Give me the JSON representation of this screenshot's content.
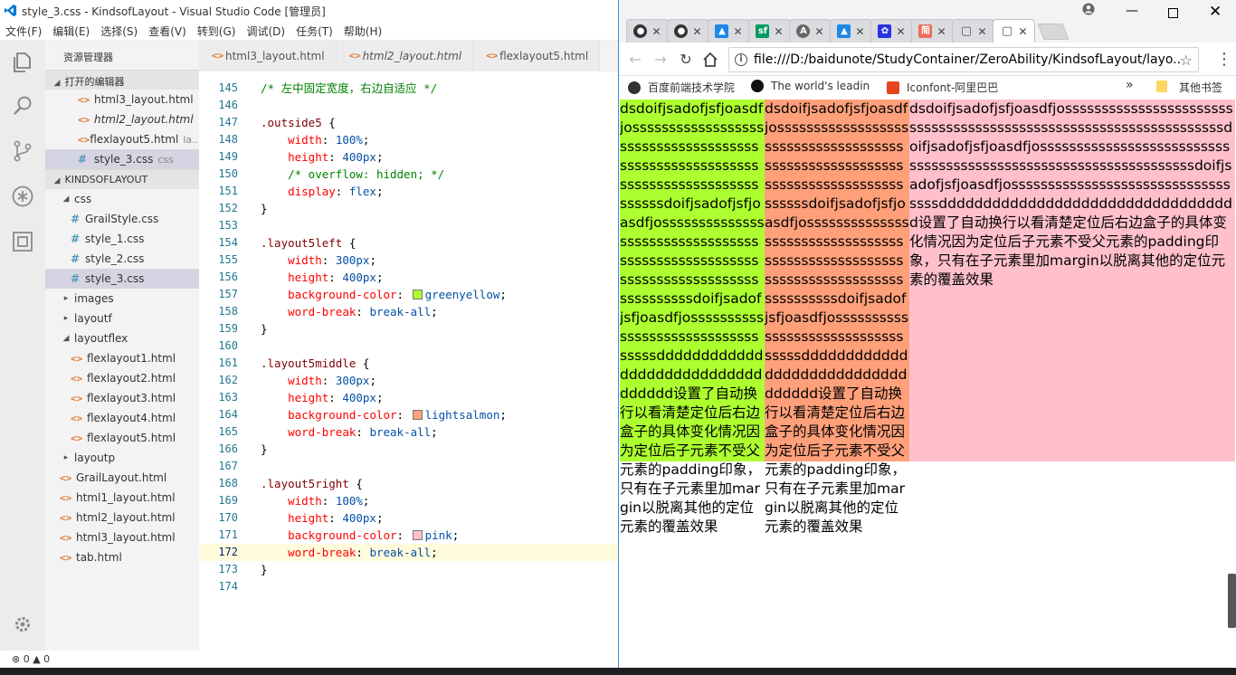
{
  "vscode": {
    "title": "style_3.css - KindsofLayout - Visual Studio Code [管理员]",
    "menu": [
      "文件(F)",
      "编辑(E)",
      "选择(S)",
      "查看(V)",
      "转到(G)",
      "调试(D)",
      "任务(T)",
      "帮助(H)"
    ],
    "explorer_title": "资源管理器",
    "open_editors_label": "打开的编辑器",
    "open_editors": [
      {
        "label": "html3_layout.html",
        "type": "html",
        "italic": false
      },
      {
        "label": "html2_layout.html",
        "type": "html",
        "italic": true
      },
      {
        "label": "flexlayout5.html",
        "type": "html",
        "italic": false,
        "desc": "la..."
      },
      {
        "label": "style_3.css",
        "type": "css",
        "italic": false,
        "desc": "css"
      }
    ],
    "project_label": "KINDSOFLAYOUT",
    "tree": [
      {
        "label": "css",
        "kind": "folder",
        "open": true,
        "depth": 1
      },
      {
        "label": "GrailStyle.css",
        "kind": "css",
        "depth": 2
      },
      {
        "label": "style_1.css",
        "kind": "css",
        "depth": 2
      },
      {
        "label": "style_2.css",
        "kind": "css",
        "depth": 2
      },
      {
        "label": "style_3.css",
        "kind": "css",
        "depth": 2
      },
      {
        "label": "images",
        "kind": "folder",
        "open": false,
        "depth": 1
      },
      {
        "label": "layoutf",
        "kind": "folder",
        "open": false,
        "depth": 1
      },
      {
        "label": "layoutflex",
        "kind": "folder",
        "open": true,
        "depth": 1
      },
      {
        "label": "flexlayout1.html",
        "kind": "html",
        "depth": 2
      },
      {
        "label": "flexlayout2.html",
        "kind": "html",
        "depth": 2
      },
      {
        "label": "flexlayout3.html",
        "kind": "html",
        "depth": 2
      },
      {
        "label": "flexlayout4.html",
        "kind": "html",
        "depth": 2
      },
      {
        "label": "flexlayout5.html",
        "kind": "html",
        "depth": 2
      },
      {
        "label": "layoutp",
        "kind": "folder",
        "open": false,
        "depth": 1
      },
      {
        "label": "GrailLayout.html",
        "kind": "html",
        "depth": 1
      },
      {
        "label": "html1_layout.html",
        "kind": "html",
        "depth": 1
      },
      {
        "label": "html2_layout.html",
        "kind": "html",
        "depth": 1
      },
      {
        "label": "html3_layout.html",
        "kind": "html",
        "depth": 1
      },
      {
        "label": "tab.html",
        "kind": "html",
        "depth": 1
      }
    ],
    "tabs": [
      {
        "label": "html3_layout.html",
        "italic": false
      },
      {
        "label": "html2_layout.html",
        "italic": true
      },
      {
        "label": "flexlayout5.html",
        "italic": false
      }
    ],
    "code_lines": [
      {
        "n": "145",
        "parts": [
          [
            "cm",
            "/* 左中固定宽度，右边自适应 */"
          ]
        ]
      },
      {
        "n": "146",
        "parts": []
      },
      {
        "n": "147",
        "parts": [
          [
            "sel",
            ".outside5"
          ],
          [
            "pn",
            " {"
          ]
        ]
      },
      {
        "n": "148",
        "parts": [
          [
            "pn",
            "    "
          ],
          [
            "prop",
            "width"
          ],
          [
            "pn",
            ": "
          ],
          [
            "val",
            "100%"
          ],
          [
            "pn",
            ";"
          ]
        ]
      },
      {
        "n": "149",
        "parts": [
          [
            "pn",
            "    "
          ],
          [
            "prop",
            "height"
          ],
          [
            "pn",
            ": "
          ],
          [
            "val",
            "400px"
          ],
          [
            "pn",
            ";"
          ]
        ]
      },
      {
        "n": "150",
        "parts": [
          [
            "pn",
            "    "
          ],
          [
            "cm",
            "/* overflow: hidden; */"
          ]
        ]
      },
      {
        "n": "151",
        "parts": [
          [
            "pn",
            "    "
          ],
          [
            "prop",
            "display"
          ],
          [
            "pn",
            ": "
          ],
          [
            "val",
            "flex"
          ],
          [
            "pn",
            ";"
          ]
        ]
      },
      {
        "n": "152",
        "parts": [
          [
            "pn",
            "}"
          ]
        ]
      },
      {
        "n": "153",
        "parts": []
      },
      {
        "n": "154",
        "parts": [
          [
            "sel",
            ".layout5left"
          ],
          [
            "pn",
            " {"
          ]
        ]
      },
      {
        "n": "155",
        "parts": [
          [
            "pn",
            "    "
          ],
          [
            "prop",
            "width"
          ],
          [
            "pn",
            ": "
          ],
          [
            "val",
            "300px"
          ],
          [
            "pn",
            ";"
          ]
        ]
      },
      {
        "n": "156",
        "parts": [
          [
            "pn",
            "    "
          ],
          [
            "prop",
            "height"
          ],
          [
            "pn",
            ": "
          ],
          [
            "val",
            "400px"
          ],
          [
            "pn",
            ";"
          ]
        ]
      },
      {
        "n": "157",
        "parts": [
          [
            "pn",
            "    "
          ],
          [
            "prop",
            "background-color"
          ],
          [
            "pn",
            ": "
          ],
          [
            "sw",
            "#adff2f"
          ],
          [
            "val",
            "greenyellow"
          ],
          [
            "pn",
            ";"
          ]
        ]
      },
      {
        "n": "158",
        "parts": [
          [
            "pn",
            "    "
          ],
          [
            "prop",
            "word-break"
          ],
          [
            "pn",
            ": "
          ],
          [
            "val",
            "break-all"
          ],
          [
            "pn",
            ";"
          ]
        ]
      },
      {
        "n": "159",
        "parts": [
          [
            "pn",
            "}"
          ]
        ]
      },
      {
        "n": "160",
        "parts": []
      },
      {
        "n": "161",
        "parts": [
          [
            "sel",
            ".layout5middle"
          ],
          [
            "pn",
            " {"
          ]
        ]
      },
      {
        "n": "162",
        "parts": [
          [
            "pn",
            "    "
          ],
          [
            "prop",
            "width"
          ],
          [
            "pn",
            ": "
          ],
          [
            "val",
            "300px"
          ],
          [
            "pn",
            ";"
          ]
        ]
      },
      {
        "n": "163",
        "parts": [
          [
            "pn",
            "    "
          ],
          [
            "prop",
            "height"
          ],
          [
            "pn",
            ": "
          ],
          [
            "val",
            "400px"
          ],
          [
            "pn",
            ";"
          ]
        ]
      },
      {
        "n": "164",
        "parts": [
          [
            "pn",
            "    "
          ],
          [
            "prop",
            "background-color"
          ],
          [
            "pn",
            ": "
          ],
          [
            "sw",
            "#ffa07a"
          ],
          [
            "val",
            "lightsalmon"
          ],
          [
            "pn",
            ";"
          ]
        ]
      },
      {
        "n": "165",
        "parts": [
          [
            "pn",
            "    "
          ],
          [
            "prop",
            "word-break"
          ],
          [
            "pn",
            ": "
          ],
          [
            "val",
            "break-all"
          ],
          [
            "pn",
            ";"
          ]
        ]
      },
      {
        "n": "166",
        "parts": [
          [
            "pn",
            "}"
          ]
        ]
      },
      {
        "n": "167",
        "parts": []
      },
      {
        "n": "168",
        "parts": [
          [
            "sel",
            ".layout5right"
          ],
          [
            "pn",
            " {"
          ]
        ]
      },
      {
        "n": "169",
        "parts": [
          [
            "pn",
            "    "
          ],
          [
            "prop",
            "width"
          ],
          [
            "pn",
            ": "
          ],
          [
            "val",
            "100%"
          ],
          [
            "pn",
            ";"
          ]
        ]
      },
      {
        "n": "170",
        "parts": [
          [
            "pn",
            "    "
          ],
          [
            "prop",
            "height"
          ],
          [
            "pn",
            ": "
          ],
          [
            "val",
            "400px"
          ],
          [
            "pn",
            ";"
          ]
        ]
      },
      {
        "n": "171",
        "parts": [
          [
            "pn",
            "    "
          ],
          [
            "prop",
            "background-color"
          ],
          [
            "pn",
            ": "
          ],
          [
            "sw",
            "#ffc0cb"
          ],
          [
            "val",
            "pink"
          ],
          [
            "pn",
            ";"
          ]
        ]
      },
      {
        "n": "172",
        "parts": [
          [
            "pn",
            "    "
          ],
          [
            "prop",
            "word-break"
          ],
          [
            "pn",
            ": "
          ],
          [
            "val",
            "break-all"
          ],
          [
            "pn",
            ";"
          ]
        ],
        "current": true
      },
      {
        "n": "173",
        "parts": [
          [
            "pn",
            "}"
          ]
        ]
      },
      {
        "n": "174",
        "parts": []
      }
    ],
    "status": "⊗ 0  ▲ 0"
  },
  "chrome": {
    "url": "file:///D:/baidunote/StudyContainer/ZeroAbility/KindsofLayout/layo...",
    "tabs": [
      {
        "icon": "github-icon",
        "fav": "#333333",
        "glyph": "●"
      },
      {
        "icon": "github-icon",
        "fav": "#333333",
        "glyph": "●"
      },
      {
        "icon": "rocket-icon",
        "fav": "#1e88e5",
        "glyph": "▲"
      },
      {
        "icon": "sf-icon",
        "fav": "#009a61",
        "glyph": "sf"
      },
      {
        "icon": "translate-icon",
        "fav": "#666666",
        "glyph": "A"
      },
      {
        "icon": "rocket-icon",
        "fav": "#1e88e5",
        "glyph": "▲"
      },
      {
        "icon": "paw-icon",
        "fav": "#2932e1",
        "glyph": "✿"
      },
      {
        "icon": "jianshu-icon",
        "fav": "#ea6f5a",
        "glyph": "简"
      },
      {
        "icon": "page-icon",
        "fav": "#ffffff",
        "glyph": "▢"
      },
      {
        "icon": "page-icon",
        "fav": "#ffffff",
        "glyph": "▢",
        "active": true
      }
    ],
    "bookmarks": [
      {
        "label": "百度前端技术学院",
        "icon": "baidu-ife-icon",
        "color": "#333333"
      },
      {
        "label": "The world's leading",
        "icon": "github-icon",
        "color": "#111111"
      },
      {
        "label": "Iconfont-阿里巴巴",
        "icon": "iconfont-icon",
        "color": "#e6431e"
      }
    ],
    "bookmarks_more": "»",
    "other_bookmarks": "其他书签"
  },
  "page": {
    "left_text": "dsdoifjsadofjsfjoasdfjosssssssssssssssssssssssssssssssssssssssssssssssssssssssssssssssssssssssssssssssssdoifjsadofjsfjoasdfjosssssssssssssssssssssssssssssssssssssssssssssssssssssssssssssssssssssssssssssssssdoifjsadofjsfjoasdfjossssssssssssssssssssssssssssssssssdddddddddddddddddddddddddddddddddd设置了自动换行以看清楚定位后右边盒子的具体变化情况因为定位后子元素不受父元素的padding印象，只有在子元素里加margin以脱离其他的定位元素的覆盖效果",
    "middle_text": "dsdoifjsadofjsfjoasdfjosssssssssssssssssssssssssssssssssssssssssssssssssssssssssssssssssssssssssssssssssdoifjsadofjsfjoasdfjosssssssssssssssssssssssssssssssssssssssssssssssssssssssssssssssssssssssssssssssssdoifjsadofjsfjoasdfjossssssssssssssssssssssssssssssssssdddddddddddddddddddddddddddddddddd设置了自动换行以看清楚定位后右边盒子的具体变化情况因为定位后子元素不受父元素的padding印象，只有在子元素里加margin以脱离其他的定位元素的覆盖效果",
    "right_text": "dsdoifjsadofjsfjoasdfjossssssssssssssssssssssssssssssssssssssssssssssssssssssssssssssssssdoifjsadofjsfjoasdfjosssssssssssssssssssssssssssssssssssssssssssssssssssssssssssssssssdoifjsadofjsfjoasdfjossssssssssssssssssssssssssssssssssdddddddddddddddddddddddddddddddddd设置了自动换行以看清楚定位后右边盒子的具体变化情况因为定位后子元素不受父元素的padding印象，只有在子元素里加margin以脱离其他的定位元素的覆盖效果",
    "colors": {
      "left": "#adff2f",
      "middle": "#ffa07a",
      "right": "#ffc0cb"
    }
  }
}
